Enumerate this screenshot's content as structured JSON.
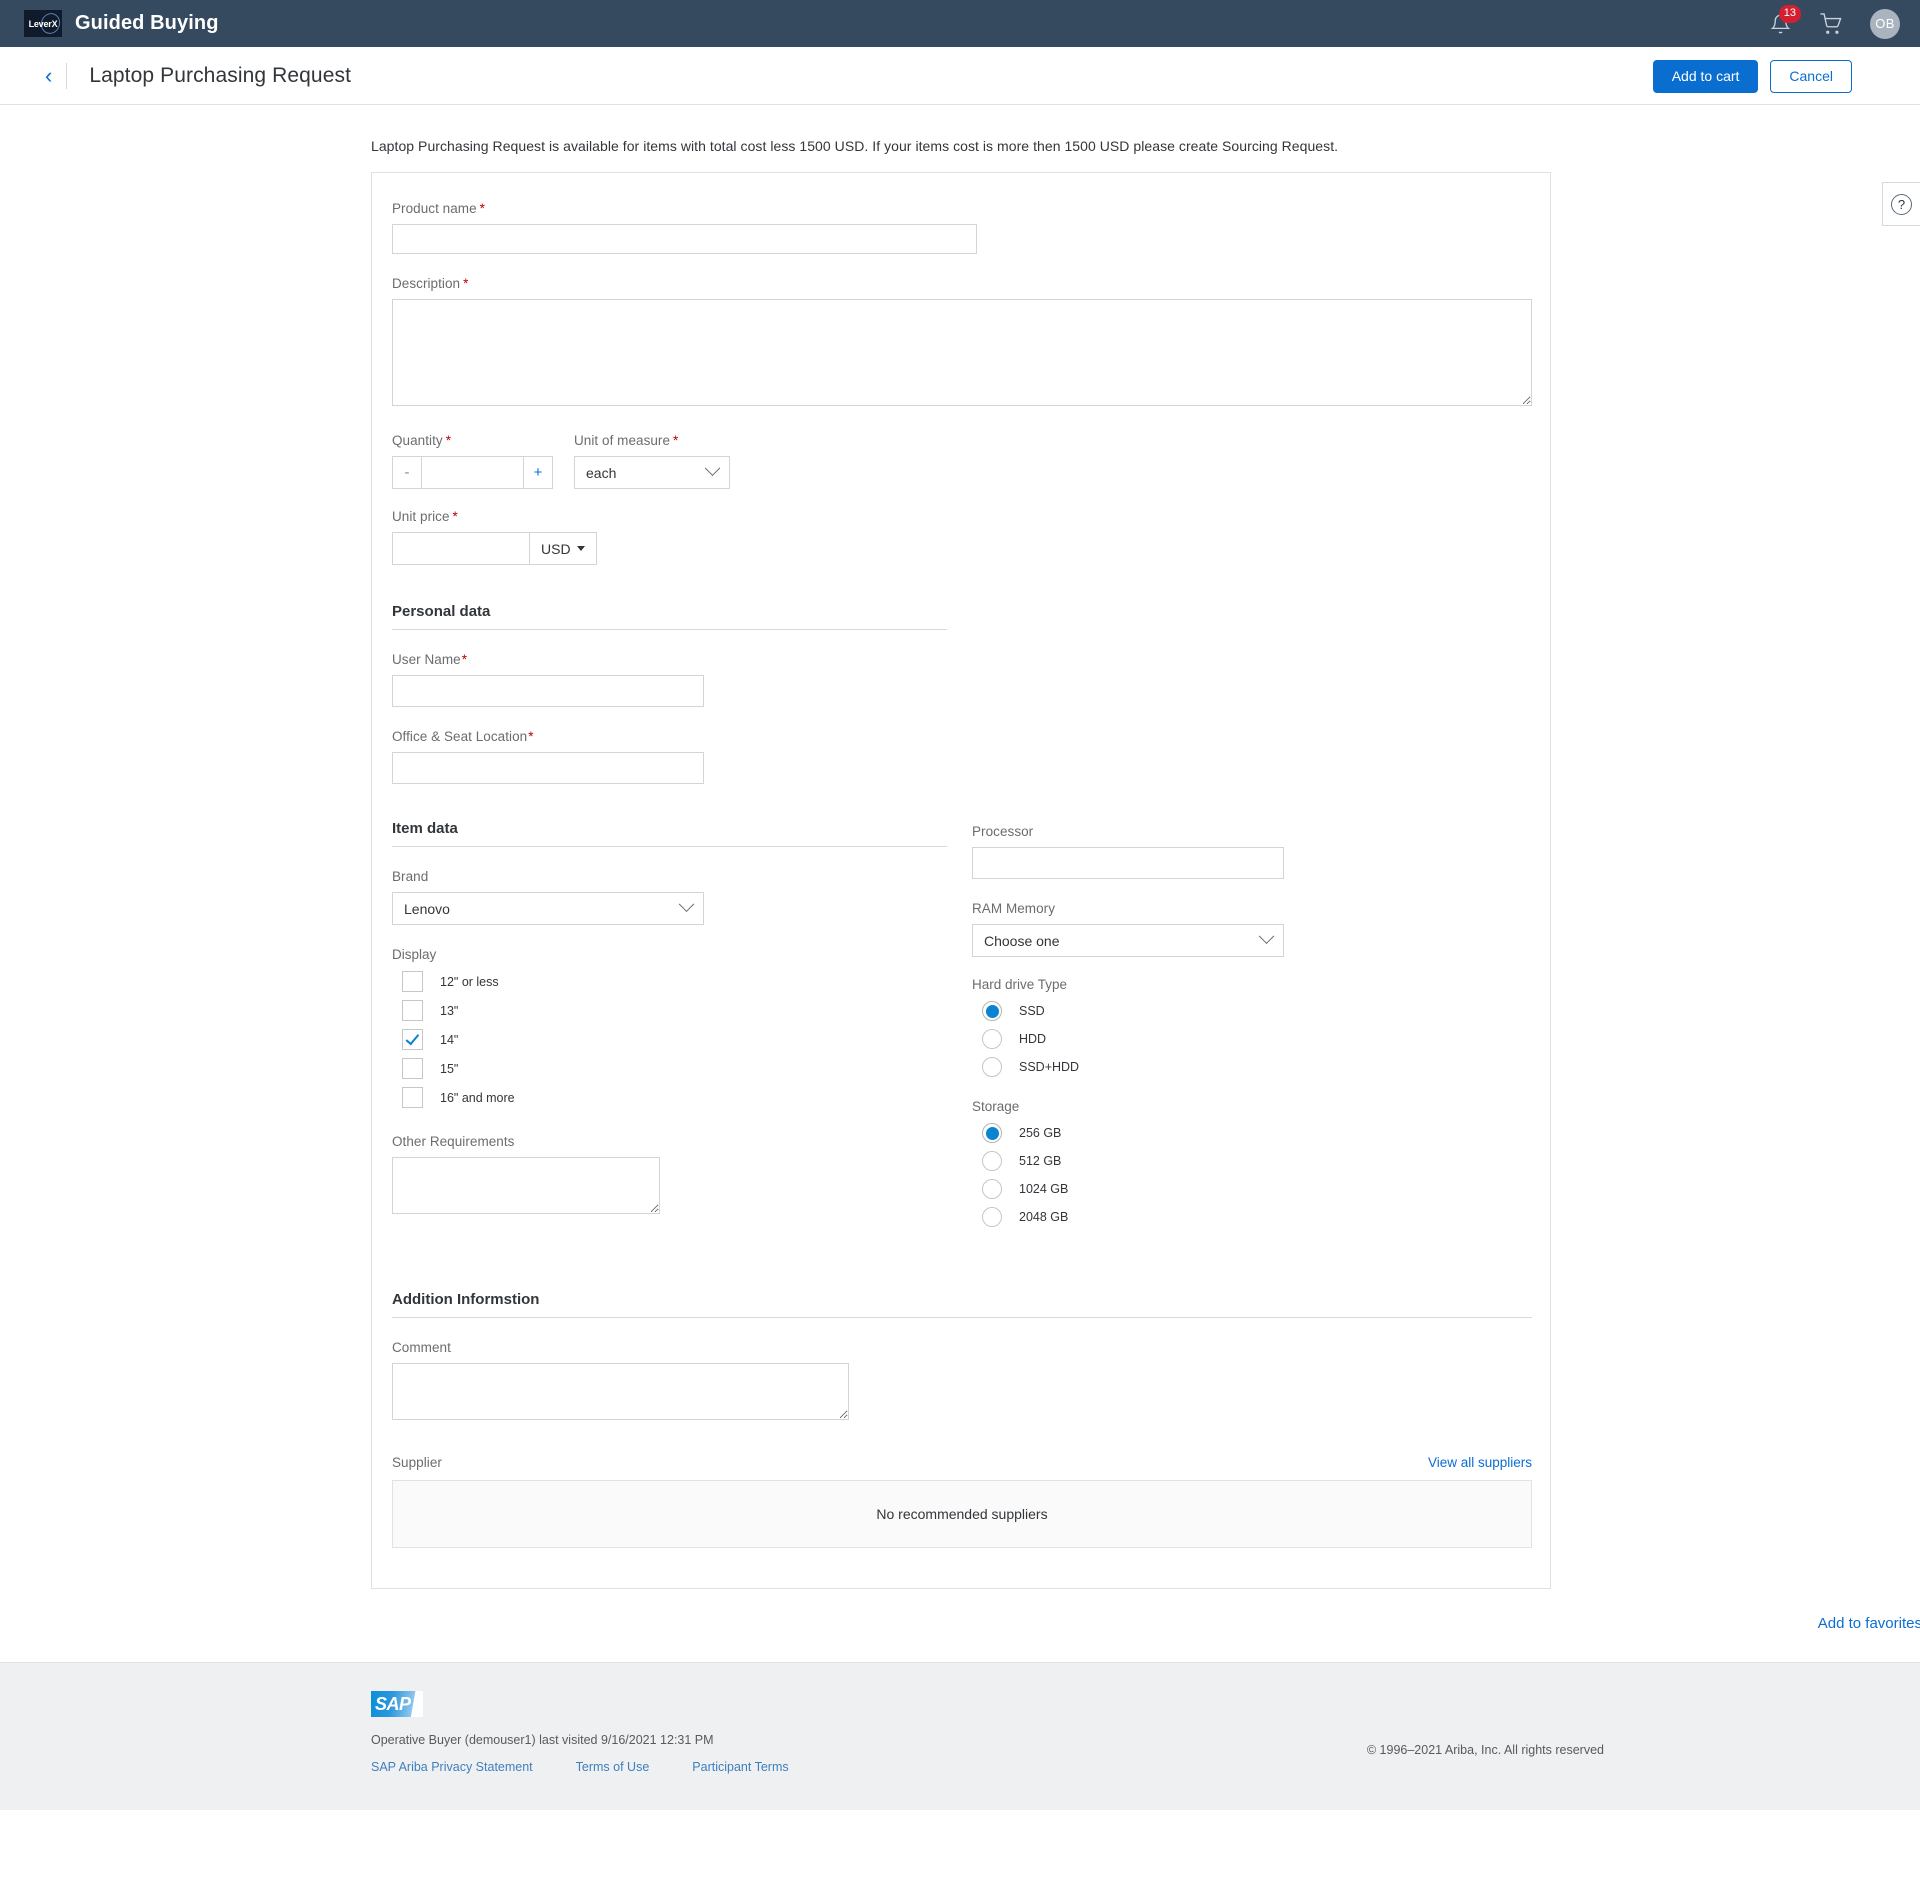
{
  "header": {
    "brand_title": "Guided Buying",
    "logo_text": "LeverX",
    "notification_count": "13",
    "bell_icon": "bell-icon",
    "cart_icon": "shopping-cart-icon",
    "avatar_initials": "OB"
  },
  "subheader": {
    "back_icon": "chevron-left-icon",
    "title": "Laptop Purchasing Request",
    "add_to_cart_label": "Add to cart",
    "cancel_label": "Cancel"
  },
  "help": {
    "glyph": "?"
  },
  "intro": "Laptop Purchasing Request is available for items with total cost less 1500 USD. If your items cost is more then 1500 USD please create Sourcing Request.",
  "form": {
    "product_name": {
      "label": "Product name",
      "required": "*",
      "value": ""
    },
    "description": {
      "label": "Description",
      "required": "*",
      "value": ""
    },
    "quantity": {
      "label": "Quantity",
      "required": "*",
      "value": "",
      "minus_label": "-",
      "plus_label": "+"
    },
    "unit_of_measure": {
      "label": "Unit of measure",
      "required": "*",
      "value": "each",
      "options": [
        "each"
      ]
    },
    "unit_price": {
      "label": "Unit price",
      "required": "*",
      "value": "",
      "currency": "USD",
      "currency_options": [
        "USD"
      ]
    }
  },
  "personal_data": {
    "heading": "Personal data",
    "user_name": {
      "label": "User Name",
      "required": "*",
      "value": ""
    },
    "office_seat": {
      "label": "Office & Seat Location",
      "required": "*",
      "value": ""
    }
  },
  "item_data": {
    "heading": "Item data",
    "brand": {
      "label": "Brand",
      "value": "Lenovo",
      "options": [
        "Lenovo"
      ]
    },
    "display": {
      "label": "Display",
      "options": [
        {
          "label": "12\" or less",
          "checked": false
        },
        {
          "label": "13\"",
          "checked": false
        },
        {
          "label": "14\"",
          "checked": true
        },
        {
          "label": "15\"",
          "checked": false
        },
        {
          "label": "16\" and more",
          "checked": false
        }
      ]
    },
    "other_requirements": {
      "label": "Other Requirements",
      "value": ""
    },
    "processor": {
      "label": "Processor",
      "value": ""
    },
    "ram_memory": {
      "label": "RAM Memory",
      "value": "Choose one",
      "options": [
        "Choose one"
      ]
    },
    "hard_drive_type": {
      "label": "Hard drive Type",
      "options": [
        {
          "label": "SSD",
          "selected": true
        },
        {
          "label": "HDD",
          "selected": false
        },
        {
          "label": "SSD+HDD",
          "selected": false
        }
      ]
    },
    "storage": {
      "label": "Storage",
      "options": [
        {
          "label": "256 GB",
          "selected": true
        },
        {
          "label": "512 GB",
          "selected": false
        },
        {
          "label": "1024 GB",
          "selected": false
        },
        {
          "label": "2048 GB",
          "selected": false
        }
      ]
    }
  },
  "additional": {
    "heading": "Addition Informstion",
    "comment": {
      "label": "Comment",
      "value": ""
    },
    "supplier_label": "Supplier",
    "view_all_suppliers": "View all suppliers",
    "no_suppliers": "No recommended suppliers"
  },
  "favorites": {
    "label": "Add to favorites"
  },
  "footer": {
    "logo_text": "SAP",
    "session": "Operative Buyer (demouser1) last visited 9/16/2021 12:31 PM",
    "links": [
      "SAP Ariba Privacy Statement",
      "Terms of Use",
      "Participant Terms"
    ],
    "copyright": "© 1996–2021 Ariba, Inc. All rights reserved"
  },
  "colors": {
    "header_bg": "#354a5f",
    "accent_blue": "#0a6ed1",
    "checkbox_blue": "#0a84d1",
    "required_red": "#bb0000",
    "badge_red": "#d32030"
  }
}
